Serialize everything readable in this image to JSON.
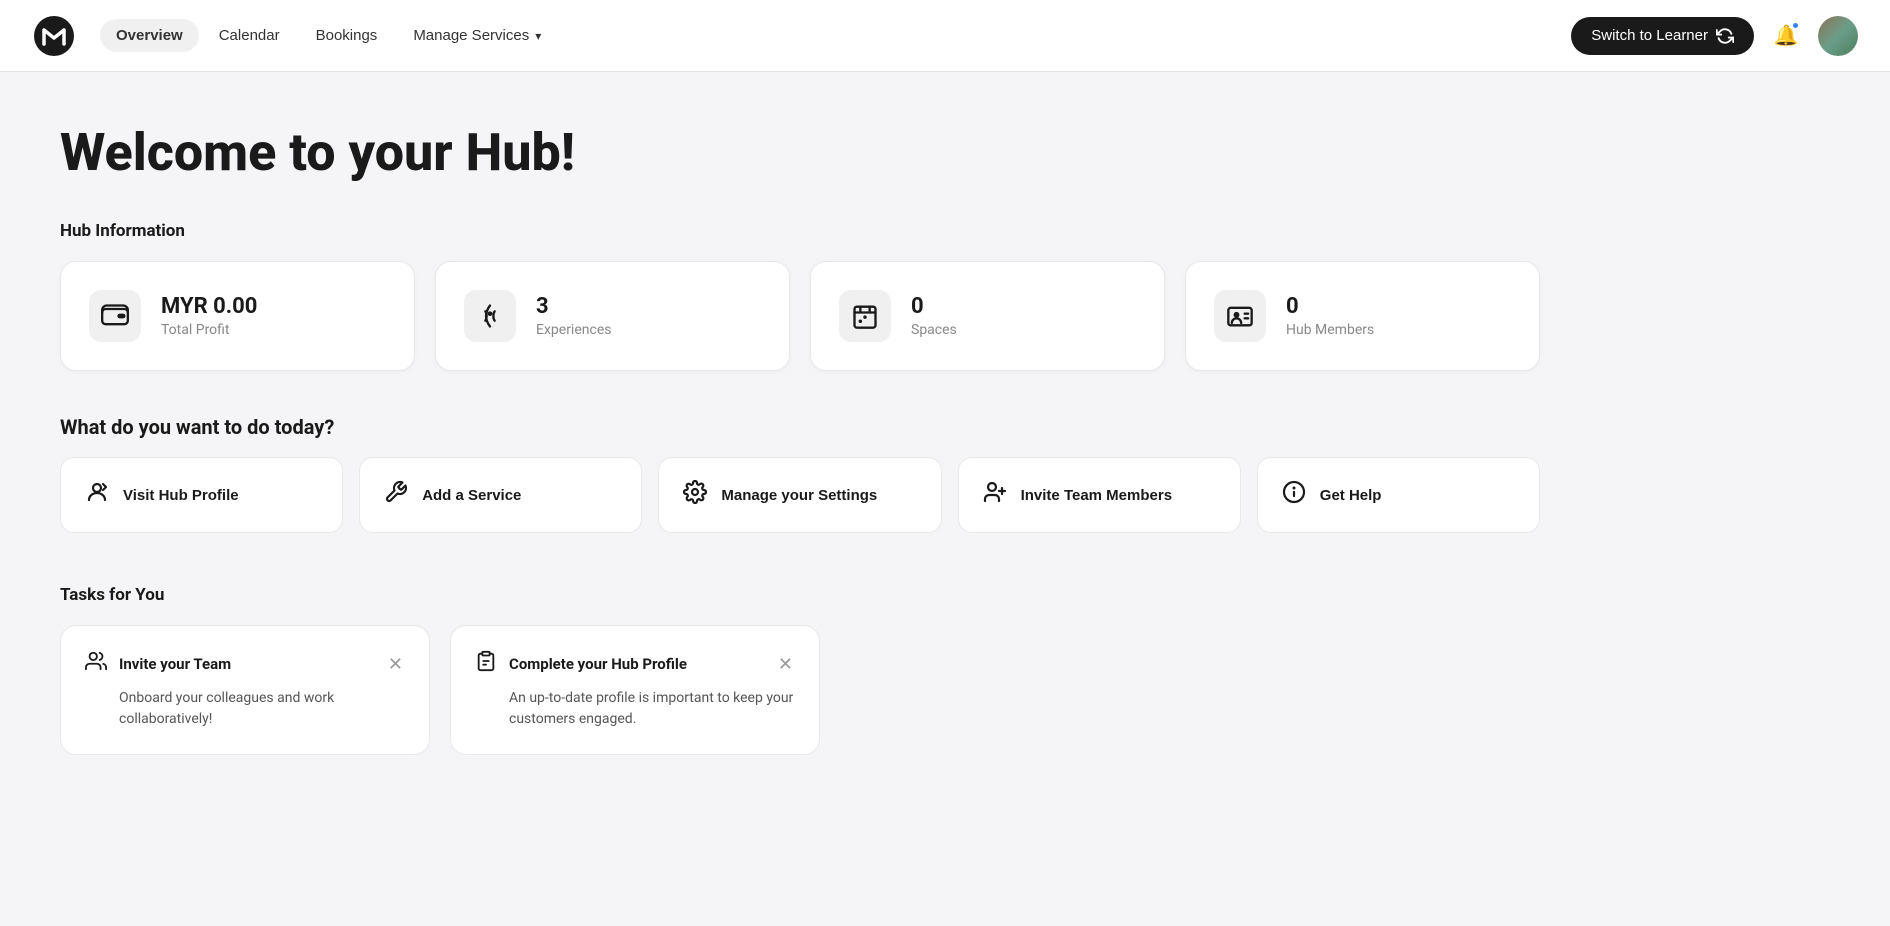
{
  "nav": {
    "logo_alt": "Meiro logo",
    "items": [
      {
        "label": "Overview",
        "active": true,
        "id": "overview"
      },
      {
        "label": "Calendar",
        "active": false,
        "id": "calendar"
      },
      {
        "label": "Bookings",
        "active": false,
        "id": "bookings"
      },
      {
        "label": "Manage Services",
        "active": false,
        "id": "manage-services",
        "has_dropdown": true
      }
    ],
    "switch_learner_label": "Switch to Learner",
    "switch_icon": "↺"
  },
  "main": {
    "welcome_title": "Welcome to your Hub!",
    "hub_info_label": "Hub Information",
    "stats": [
      {
        "id": "profit",
        "value": "MYR 0.00",
        "name": "Total Profit",
        "icon": "wallet"
      },
      {
        "id": "experiences",
        "value": "3",
        "name": "Experiences",
        "icon": "skate"
      },
      {
        "id": "spaces",
        "value": "0",
        "name": "Spaces",
        "icon": "calendar-star"
      },
      {
        "id": "members",
        "value": "0",
        "name": "Hub Members",
        "icon": "id-card"
      }
    ],
    "actions_question": "What do you want to do today?",
    "actions": [
      {
        "id": "visit-hub-profile",
        "label": "Visit Hub Profile",
        "icon": "hub-profile"
      },
      {
        "id": "add-service",
        "label": "Add a Service",
        "icon": "add-service"
      },
      {
        "id": "manage-settings",
        "label": "Manage your Settings",
        "icon": "gear"
      },
      {
        "id": "invite-team",
        "label": "Invite Team Members",
        "icon": "invite-team"
      },
      {
        "id": "get-help",
        "label": "Get Help",
        "icon": "info"
      }
    ],
    "tasks_label": "Tasks for You",
    "tasks": [
      {
        "id": "invite-team-task",
        "icon": "team-icon",
        "title": "Invite your Team",
        "description": "Onboard your colleagues and work collaboratively!"
      },
      {
        "id": "complete-hub-profile-task",
        "icon": "clipboard-icon",
        "title": "Complete your Hub Profile",
        "description": "An up-to-date profile is important to keep your customers engaged."
      }
    ]
  }
}
